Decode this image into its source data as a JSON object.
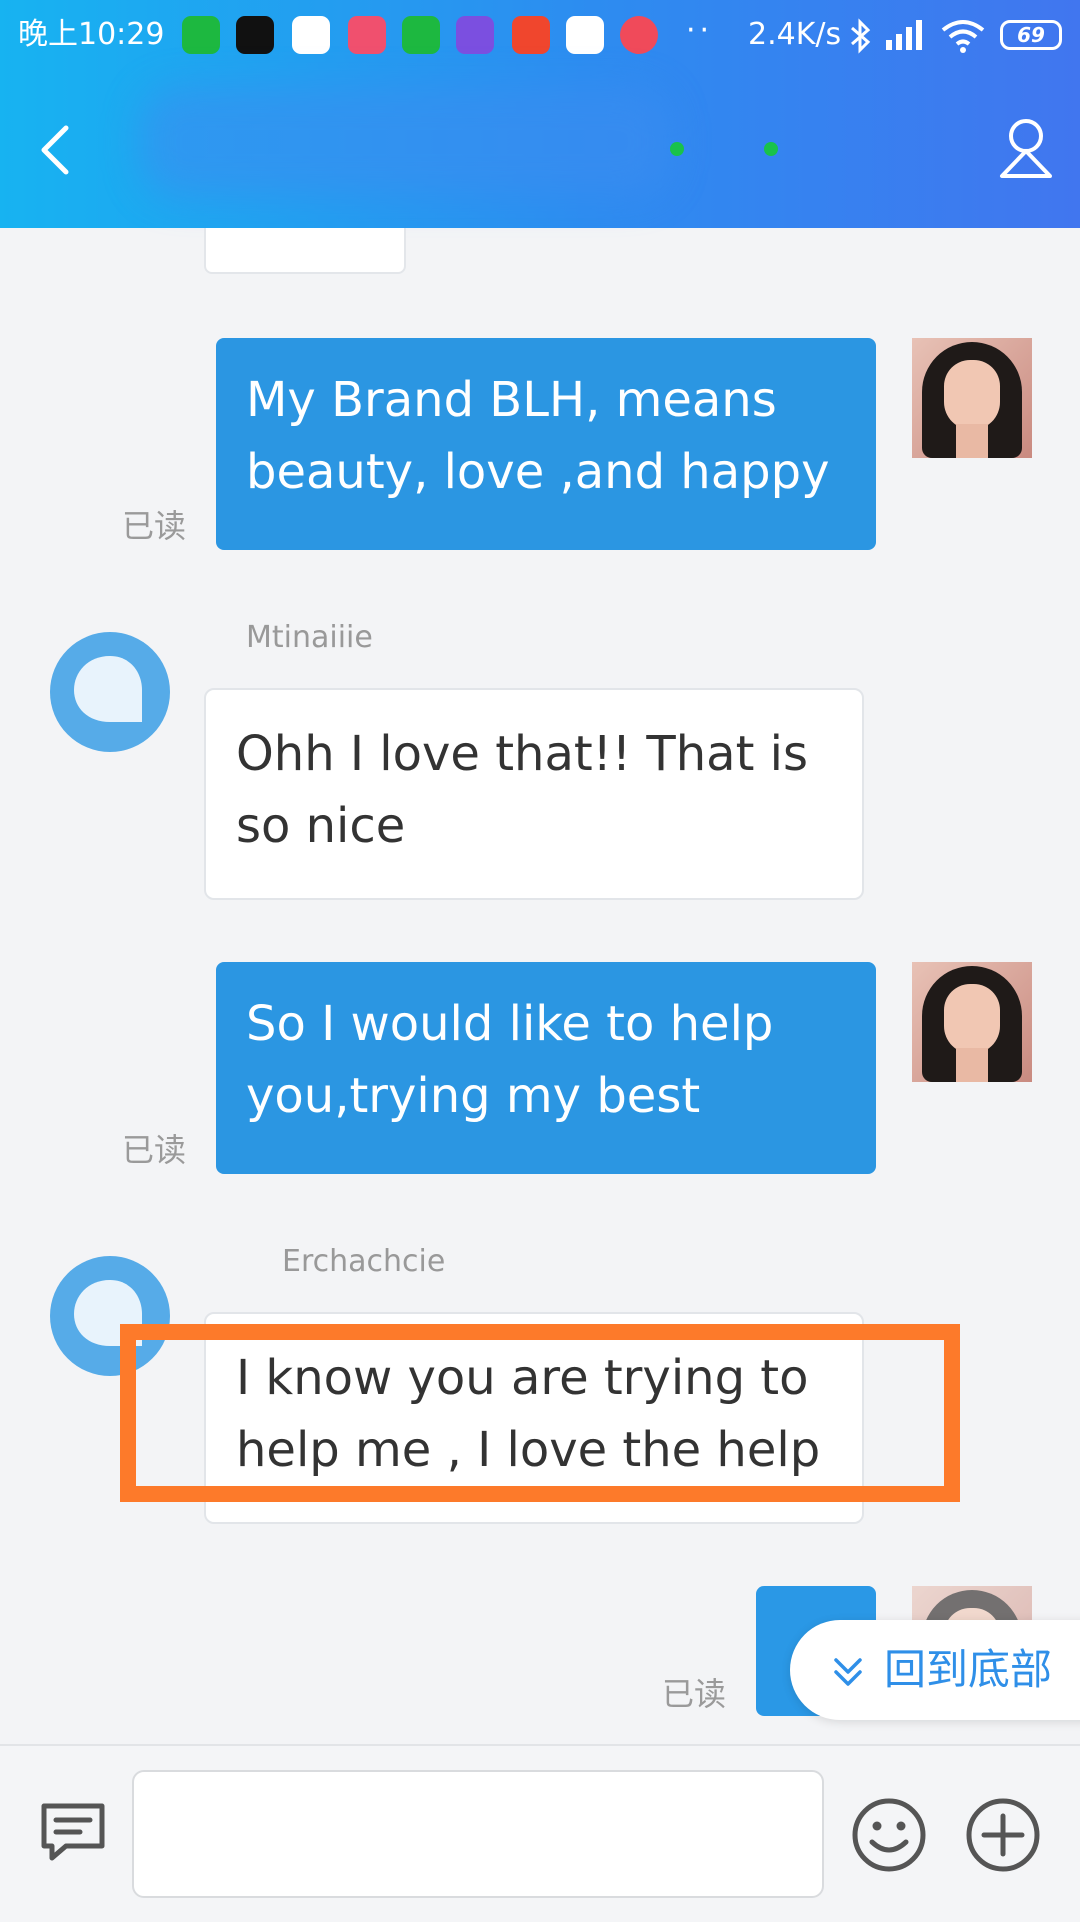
{
  "status_bar": {
    "time": "晚上10:29",
    "dots": "··",
    "speed": "2.4K/s",
    "battery": "69"
  },
  "chat": {
    "messages": [
      {
        "side": "out",
        "text": "My Brand BLH, means beauty, love ,and happy",
        "read": "已读"
      },
      {
        "side": "in",
        "sender": "Mtinaiiie",
        "text": "Ohh I love that!! That is so nice"
      },
      {
        "side": "out",
        "text": "So I would like to help you,trying my best",
        "read": "已读"
      },
      {
        "side": "in",
        "sender": "Erchachcie",
        "text": "I know you are trying to help me , I love the help"
      },
      {
        "side": "out",
        "text": "",
        "read": "已读"
      }
    ],
    "back_to_bottom": "回到底部"
  },
  "colors": {
    "header_start": "#17b3f1",
    "header_end": "#4176ef",
    "outgoing_bubble": "#2b96e2",
    "highlight_box": "#fd7a2a",
    "back_to_bottom_text": "#2f8fe8"
  }
}
